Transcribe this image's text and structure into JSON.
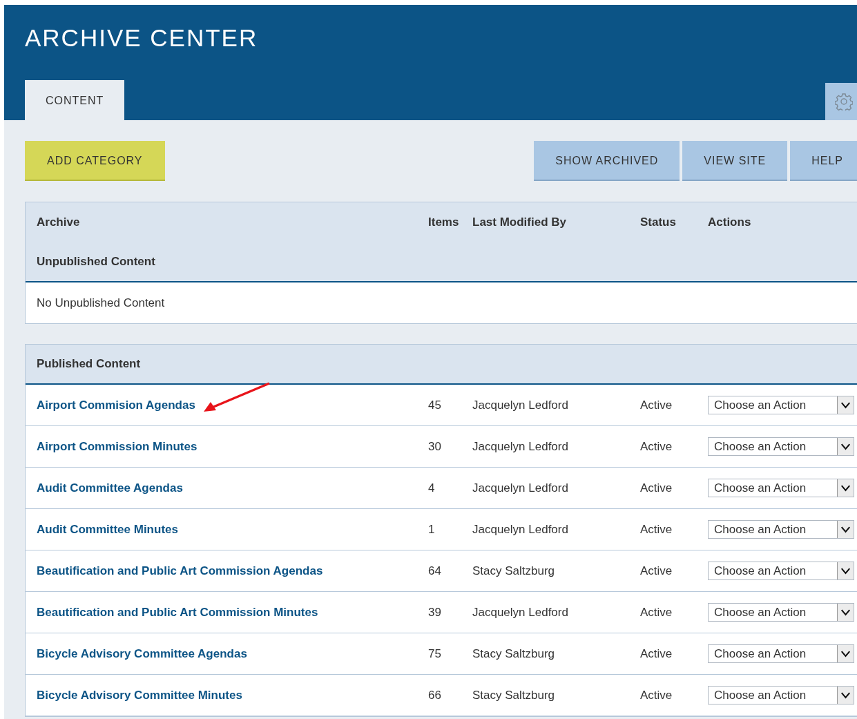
{
  "header": {
    "title": "ARCHIVE CENTER"
  },
  "tabs": [
    {
      "label": "CONTENT",
      "selected": true
    }
  ],
  "toolbar": {
    "primary_button": "ADD CATEGORY",
    "buttons": [
      "SHOW ARCHIVED",
      "VIEW SITE",
      "HELP"
    ]
  },
  "table": {
    "columns": [
      "Archive",
      "Items",
      "Last Modified By",
      "Status",
      "Actions"
    ],
    "unpublished": {
      "title": "Unpublished Content",
      "empty_text": "No Unpublished Content"
    },
    "published": {
      "title": "Published Content",
      "rows": [
        {
          "name": "Airport Commision Agendas",
          "items": "45",
          "modified_by": "Jacquelyn Ledford",
          "status": "Active",
          "action": "Choose an Action",
          "marked": true
        },
        {
          "name": "Airport Commission Minutes",
          "items": "30",
          "modified_by": "Jacquelyn Ledford",
          "status": "Active",
          "action": "Choose an Action",
          "marked": false
        },
        {
          "name": "Audit Committee Agendas",
          "items": "4",
          "modified_by": "Jacquelyn Ledford",
          "status": "Active",
          "action": "Choose an Action",
          "marked": false
        },
        {
          "name": "Audit Committee Minutes",
          "items": "1",
          "modified_by": "Jacquelyn Ledford",
          "status": "Active",
          "action": "Choose an Action",
          "marked": false
        },
        {
          "name": "Beautification and Public Art Commission Agendas",
          "items": "64",
          "modified_by": "Stacy Saltzburg",
          "status": "Active",
          "action": "Choose an Action",
          "marked": false
        },
        {
          "name": "Beautification and Public Art Commission Minutes",
          "items": "39",
          "modified_by": "Jacquelyn Ledford",
          "status": "Active",
          "action": "Choose an Action",
          "marked": false
        },
        {
          "name": "Bicycle Advisory Committee Agendas",
          "items": "75",
          "modified_by": "Stacy Saltzburg",
          "status": "Active",
          "action": "Choose an Action",
          "marked": false
        },
        {
          "name": "Bicycle Advisory Committee Minutes",
          "items": "66",
          "modified_by": "Stacy Saltzburg",
          "status": "Active",
          "action": "Choose an Action",
          "marked": false
        }
      ]
    }
  }
}
